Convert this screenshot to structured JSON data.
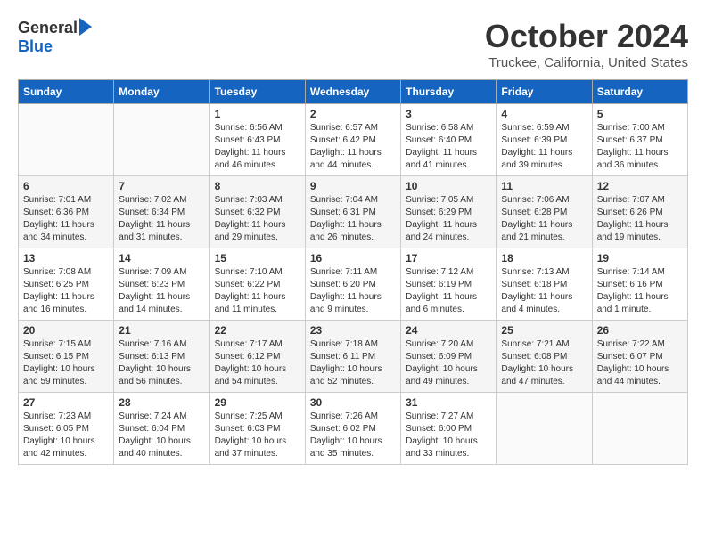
{
  "logo": {
    "general": "General",
    "blue": "Blue"
  },
  "title": "October 2024",
  "location": "Truckee, California, United States",
  "days_header": [
    "Sunday",
    "Monday",
    "Tuesday",
    "Wednesday",
    "Thursday",
    "Friday",
    "Saturday"
  ],
  "weeks": [
    [
      {
        "day": "",
        "sunrise": "",
        "sunset": "",
        "daylight": ""
      },
      {
        "day": "",
        "sunrise": "",
        "sunset": "",
        "daylight": ""
      },
      {
        "day": "1",
        "sunrise": "Sunrise: 6:56 AM",
        "sunset": "Sunset: 6:43 PM",
        "daylight": "Daylight: 11 hours and 46 minutes."
      },
      {
        "day": "2",
        "sunrise": "Sunrise: 6:57 AM",
        "sunset": "Sunset: 6:42 PM",
        "daylight": "Daylight: 11 hours and 44 minutes."
      },
      {
        "day": "3",
        "sunrise": "Sunrise: 6:58 AM",
        "sunset": "Sunset: 6:40 PM",
        "daylight": "Daylight: 11 hours and 41 minutes."
      },
      {
        "day": "4",
        "sunrise": "Sunrise: 6:59 AM",
        "sunset": "Sunset: 6:39 PM",
        "daylight": "Daylight: 11 hours and 39 minutes."
      },
      {
        "day": "5",
        "sunrise": "Sunrise: 7:00 AM",
        "sunset": "Sunset: 6:37 PM",
        "daylight": "Daylight: 11 hours and 36 minutes."
      }
    ],
    [
      {
        "day": "6",
        "sunrise": "Sunrise: 7:01 AM",
        "sunset": "Sunset: 6:36 PM",
        "daylight": "Daylight: 11 hours and 34 minutes."
      },
      {
        "day": "7",
        "sunrise": "Sunrise: 7:02 AM",
        "sunset": "Sunset: 6:34 PM",
        "daylight": "Daylight: 11 hours and 31 minutes."
      },
      {
        "day": "8",
        "sunrise": "Sunrise: 7:03 AM",
        "sunset": "Sunset: 6:32 PM",
        "daylight": "Daylight: 11 hours and 29 minutes."
      },
      {
        "day": "9",
        "sunrise": "Sunrise: 7:04 AM",
        "sunset": "Sunset: 6:31 PM",
        "daylight": "Daylight: 11 hours and 26 minutes."
      },
      {
        "day": "10",
        "sunrise": "Sunrise: 7:05 AM",
        "sunset": "Sunset: 6:29 PM",
        "daylight": "Daylight: 11 hours and 24 minutes."
      },
      {
        "day": "11",
        "sunrise": "Sunrise: 7:06 AM",
        "sunset": "Sunset: 6:28 PM",
        "daylight": "Daylight: 11 hours and 21 minutes."
      },
      {
        "day": "12",
        "sunrise": "Sunrise: 7:07 AM",
        "sunset": "Sunset: 6:26 PM",
        "daylight": "Daylight: 11 hours and 19 minutes."
      }
    ],
    [
      {
        "day": "13",
        "sunrise": "Sunrise: 7:08 AM",
        "sunset": "Sunset: 6:25 PM",
        "daylight": "Daylight: 11 hours and 16 minutes."
      },
      {
        "day": "14",
        "sunrise": "Sunrise: 7:09 AM",
        "sunset": "Sunset: 6:23 PM",
        "daylight": "Daylight: 11 hours and 14 minutes."
      },
      {
        "day": "15",
        "sunrise": "Sunrise: 7:10 AM",
        "sunset": "Sunset: 6:22 PM",
        "daylight": "Daylight: 11 hours and 11 minutes."
      },
      {
        "day": "16",
        "sunrise": "Sunrise: 7:11 AM",
        "sunset": "Sunset: 6:20 PM",
        "daylight": "Daylight: 11 hours and 9 minutes."
      },
      {
        "day": "17",
        "sunrise": "Sunrise: 7:12 AM",
        "sunset": "Sunset: 6:19 PM",
        "daylight": "Daylight: 11 hours and 6 minutes."
      },
      {
        "day": "18",
        "sunrise": "Sunrise: 7:13 AM",
        "sunset": "Sunset: 6:18 PM",
        "daylight": "Daylight: 11 hours and 4 minutes."
      },
      {
        "day": "19",
        "sunrise": "Sunrise: 7:14 AM",
        "sunset": "Sunset: 6:16 PM",
        "daylight": "Daylight: 11 hours and 1 minute."
      }
    ],
    [
      {
        "day": "20",
        "sunrise": "Sunrise: 7:15 AM",
        "sunset": "Sunset: 6:15 PM",
        "daylight": "Daylight: 10 hours and 59 minutes."
      },
      {
        "day": "21",
        "sunrise": "Sunrise: 7:16 AM",
        "sunset": "Sunset: 6:13 PM",
        "daylight": "Daylight: 10 hours and 56 minutes."
      },
      {
        "day": "22",
        "sunrise": "Sunrise: 7:17 AM",
        "sunset": "Sunset: 6:12 PM",
        "daylight": "Daylight: 10 hours and 54 minutes."
      },
      {
        "day": "23",
        "sunrise": "Sunrise: 7:18 AM",
        "sunset": "Sunset: 6:11 PM",
        "daylight": "Daylight: 10 hours and 52 minutes."
      },
      {
        "day": "24",
        "sunrise": "Sunrise: 7:20 AM",
        "sunset": "Sunset: 6:09 PM",
        "daylight": "Daylight: 10 hours and 49 minutes."
      },
      {
        "day": "25",
        "sunrise": "Sunrise: 7:21 AM",
        "sunset": "Sunset: 6:08 PM",
        "daylight": "Daylight: 10 hours and 47 minutes."
      },
      {
        "day": "26",
        "sunrise": "Sunrise: 7:22 AM",
        "sunset": "Sunset: 6:07 PM",
        "daylight": "Daylight: 10 hours and 44 minutes."
      }
    ],
    [
      {
        "day": "27",
        "sunrise": "Sunrise: 7:23 AM",
        "sunset": "Sunset: 6:05 PM",
        "daylight": "Daylight: 10 hours and 42 minutes."
      },
      {
        "day": "28",
        "sunrise": "Sunrise: 7:24 AM",
        "sunset": "Sunset: 6:04 PM",
        "daylight": "Daylight: 10 hours and 40 minutes."
      },
      {
        "day": "29",
        "sunrise": "Sunrise: 7:25 AM",
        "sunset": "Sunset: 6:03 PM",
        "daylight": "Daylight: 10 hours and 37 minutes."
      },
      {
        "day": "30",
        "sunrise": "Sunrise: 7:26 AM",
        "sunset": "Sunset: 6:02 PM",
        "daylight": "Daylight: 10 hours and 35 minutes."
      },
      {
        "day": "31",
        "sunrise": "Sunrise: 7:27 AM",
        "sunset": "Sunset: 6:00 PM",
        "daylight": "Daylight: 10 hours and 33 minutes."
      },
      {
        "day": "",
        "sunrise": "",
        "sunset": "",
        "daylight": ""
      },
      {
        "day": "",
        "sunrise": "",
        "sunset": "",
        "daylight": ""
      }
    ]
  ]
}
